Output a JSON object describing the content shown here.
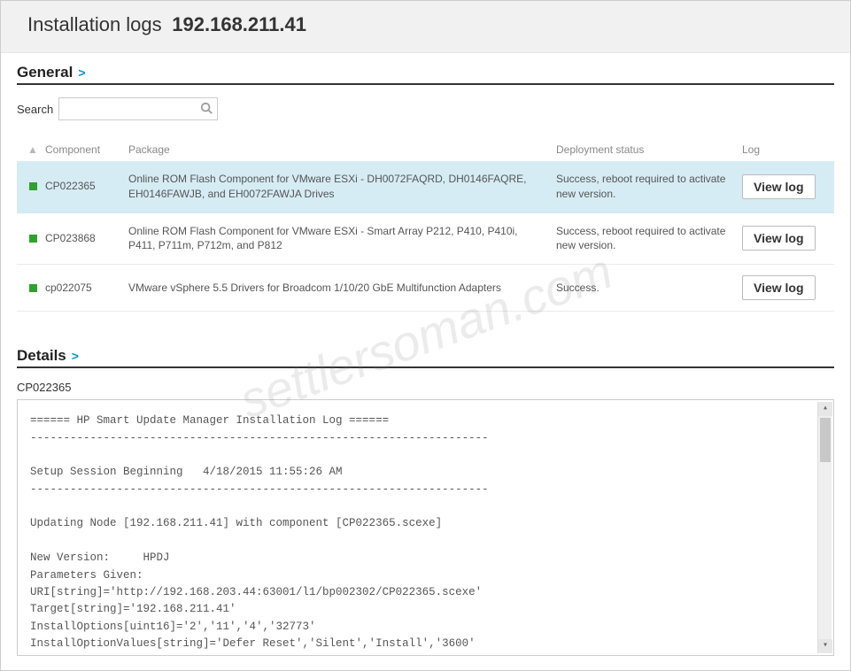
{
  "header": {
    "title": "Installation logs",
    "ip": "192.168.211.41"
  },
  "general": {
    "heading": "General",
    "search_label": "Search",
    "search_value": "",
    "columns": {
      "component": "Component",
      "package": "Package",
      "deployment": "Deployment status",
      "log": "Log"
    },
    "rows": [
      {
        "highlight": true,
        "component": "CP022365",
        "package": "Online ROM Flash Component for VMware ESXi - DH0072FAQRD, DH0146FAQRE, EH0146FAWJB, and EH0072FAWJA Drives",
        "deployment": "Success, reboot required to activate new version.",
        "log_btn": "View log"
      },
      {
        "highlight": false,
        "component": "CP023868",
        "package": "Online ROM Flash Component for VMware ESXi - Smart Array P212, P410, P410i, P411, P711m, P712m, and P812",
        "deployment": "Success, reboot required to activate new version.",
        "log_btn": "View log"
      },
      {
        "highlight": false,
        "component": "cp022075",
        "package": "VMware vSphere 5.5 Drivers for Broadcom 1/10/20 GbE Multifunction Adapters",
        "deployment": "Success.",
        "log_btn": "View log"
      }
    ]
  },
  "details": {
    "heading": "Details",
    "selected_component": "CP022365",
    "log_text": "====== HP Smart Update Manager Installation Log ======\n---------------------------------------------------------------------\n\nSetup Session Beginning   4/18/2015 11:55:26 AM\n---------------------------------------------------------------------\n\nUpdating Node [192.168.211.41] with component [CP022365.scexe]\n\nNew Version:     HPDJ\nParameters Given:\nURI[string]='http://192.168.203.44:63001/l1/bp002302/CP022365.scexe'\nTarget[string]='192.168.211.41'\nInstallOptions[uint16]='2','11','4','32773'\nInstallOptionValues[string]='Defer Reset','Silent','Install','3600'"
  },
  "watermark": "settlersoman.com"
}
